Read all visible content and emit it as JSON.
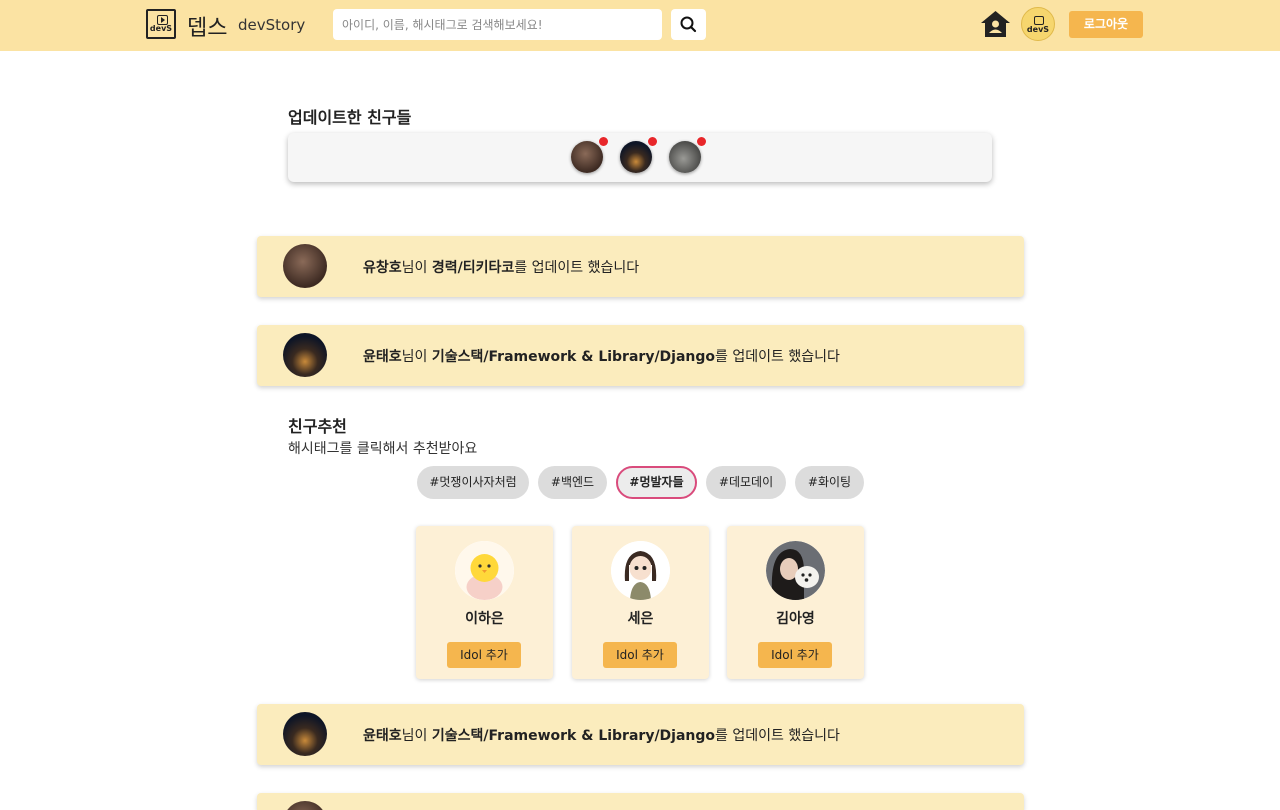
{
  "header": {
    "logo_text": "devS",
    "brand_kr": "뎁스",
    "brand_en": "devStory",
    "search_placeholder": "아이디, 이름, 해시태그로 검색해보세요!",
    "search_icon": "search-icon",
    "home_icon": "home-icon",
    "avatar_text": "devS",
    "logout_label": "로그아웃"
  },
  "updated_friends": {
    "title": "업데이트한 친구들",
    "friends": [
      {
        "name": "friend-1",
        "has_update": true
      },
      {
        "name": "friend-2",
        "has_update": true
      },
      {
        "name": "friend-3",
        "has_update": true
      }
    ]
  },
  "feed": [
    {
      "user": "유창호",
      "mid": "님이 ",
      "target": "경력/티키타코",
      "tail": "를 업데이트 했습니다"
    },
    {
      "user": "윤태호",
      "mid": "님이 ",
      "target": "기술스택/Framework & Library/Django",
      "tail": "를 업데이트 했습니다"
    },
    {
      "user": "윤태호",
      "mid": "님이 ",
      "target": "기술스택/Framework & Library/Django",
      "tail": "를 업데이트 했습니다"
    }
  ],
  "recommend": {
    "title": "친구추천",
    "subtitle": "해시태그를 클릭해서 추천받아요",
    "tags": [
      {
        "label": "#멋쟁이사자처럼",
        "active": false
      },
      {
        "label": "#백엔드",
        "active": false
      },
      {
        "label": "#멍발자들",
        "active": true
      },
      {
        "label": "#데모데이",
        "active": false
      },
      {
        "label": "#화이팅",
        "active": false
      }
    ],
    "people": [
      {
        "name": "이하은",
        "button": "Idol 추가"
      },
      {
        "name": "세은",
        "button": "Idol 추가"
      },
      {
        "name": "김아영",
        "button": "Idol 추가"
      }
    ]
  },
  "colors": {
    "header_bg": "#fbe3a3",
    "card_bg": "#fbecbd",
    "button": "#f5b64e",
    "active_tag_border": "#d94b7c",
    "update_dot": "#e8262a"
  }
}
